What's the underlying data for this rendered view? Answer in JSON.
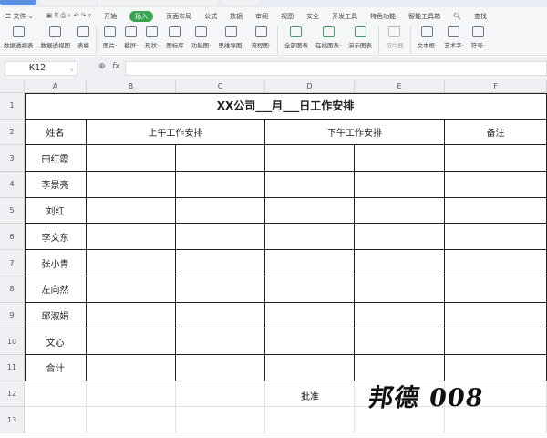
{
  "menu": {
    "items": [
      "文件",
      "开始",
      "插入",
      "页面布局",
      "公式",
      "数据",
      "审阅",
      "视图",
      "安全",
      "开发工具",
      "特色功能",
      "智能工具箱",
      "查找"
    ],
    "active": "插入"
  },
  "ribbon": [
    "数据透视表",
    "数据透视图",
    "表格",
    "图片·",
    "截屏·",
    "形状·",
    "图标库",
    "功能图·",
    "思维导图·",
    "流程图·",
    "全部图表",
    "在线图表·",
    "演示图表",
    "切片器",
    "文本框·",
    "艺术字·",
    "符号·"
  ],
  "formula": {
    "cell_ref": "K12",
    "fx": "fx",
    "value": ""
  },
  "columns": [
    "A",
    "B",
    "C",
    "D",
    "E",
    "F"
  ],
  "rows": [
    "1",
    "2",
    "3",
    "4",
    "5",
    "6",
    "7",
    "8",
    "9",
    "10",
    "11",
    "12",
    "13"
  ],
  "sheet": {
    "title": "XX公司___月___日工作安排",
    "headers": [
      "姓名",
      "上午工作安排",
      "下午工作安排",
      "备注"
    ],
    "names": [
      "田红霞",
      "李景亮",
      "刘红",
      "李文东",
      "张小青",
      "左向然",
      "邱淑娟",
      "文心",
      "合计"
    ],
    "approve": "批准",
    "signature": "邦德 008"
  },
  "colors": {
    "accent": "#3aa453"
  }
}
